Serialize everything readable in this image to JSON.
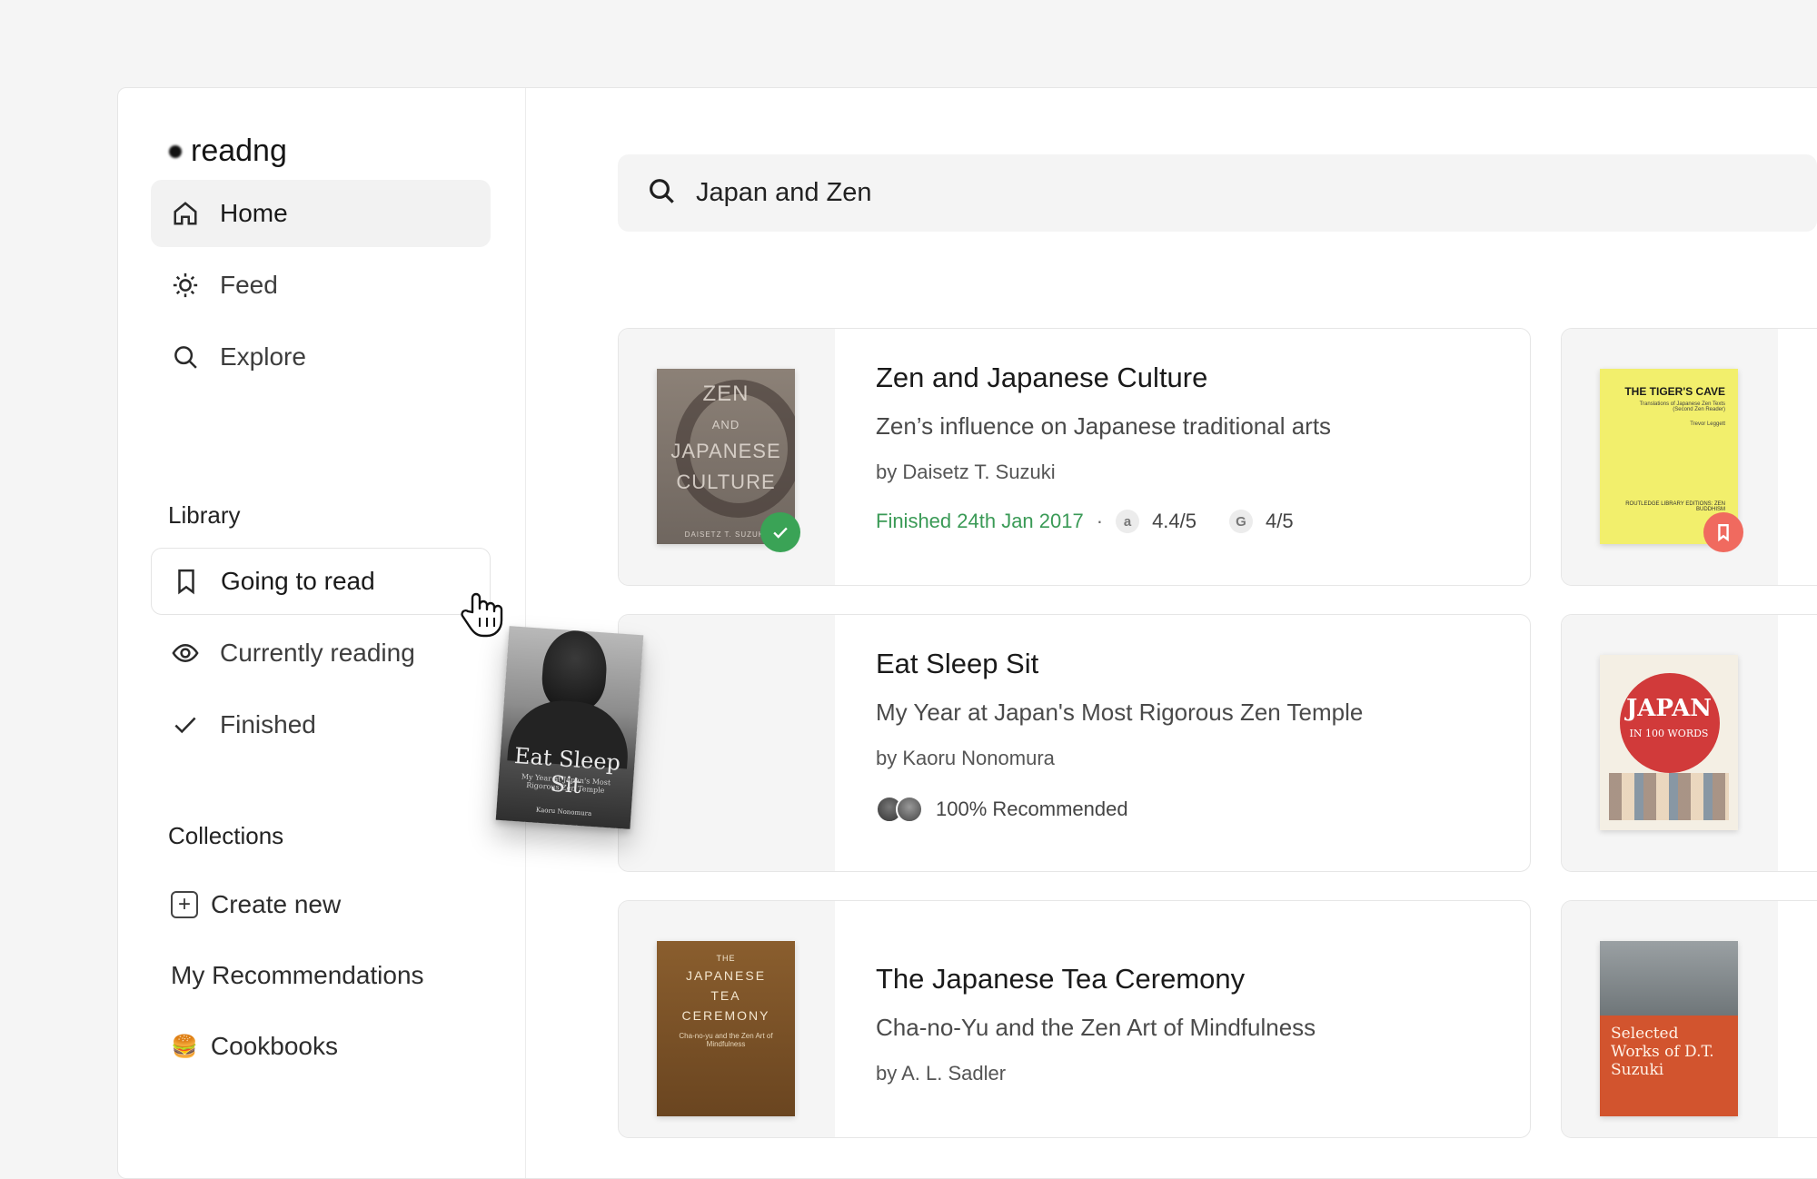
{
  "app": {
    "name": "readng"
  },
  "nav": {
    "items": [
      {
        "label": "Home",
        "icon": "home-icon"
      },
      {
        "label": "Feed",
        "icon": "sun-icon"
      },
      {
        "label": "Explore",
        "icon": "search-icon"
      }
    ]
  },
  "library": {
    "title": "Library",
    "items": [
      {
        "label": "Going to read",
        "icon": "bookmark-icon"
      },
      {
        "label": "Currently reading",
        "icon": "eye-icon"
      },
      {
        "label": "Finished",
        "icon": "check-icon"
      }
    ]
  },
  "collections": {
    "title": "Collections",
    "create_label": "Create new",
    "items": [
      {
        "label": "My Recommendations"
      },
      {
        "emoji": "🍔",
        "label": "Cookbooks"
      }
    ]
  },
  "search": {
    "query": "Japan and Zen"
  },
  "drag_book": {
    "title": "Eat Sleep Sit",
    "subtitle": "My Year at Japan's Most Rigorous Zen Temple",
    "author": "Kaoru Nonomura"
  },
  "results": [
    {
      "title": "Zen and Japanese Culture",
      "subtitle": "Zen’s influence on Japanese traditional arts",
      "author": "by Daisetz T. Suzuki",
      "status": "Finished 24th Jan 2017",
      "separator": "·",
      "amazon_rating": "4.4/5",
      "goodreads_rating": "4/5",
      "amazon_glyph": "a",
      "goodreads_glyph": "G",
      "cover": {
        "lines": [
          "ZEN",
          "AND",
          "JAPANESE",
          "CULTURE"
        ],
        "author": "DAISETZ T. SUZUKI"
      }
    },
    {
      "title": "Eat Sleep Sit",
      "subtitle": "My Year at Japan's Most Rigorous Zen Temple",
      "author": "by Kaoru Nonomura",
      "recommended": "100% Recommended"
    },
    {
      "title": "The Japanese Tea Ceremony",
      "subtitle": "Cha-no-Yu and the Zen Art of Mindfulness",
      "author": "by A. L. Sadler",
      "cover": {
        "lines": [
          "THE",
          "JAPANESE",
          "TEA",
          "CEREMONY"
        ],
        "tagline": "Cha-no-yu and the Zen Art of Mindfulness"
      }
    }
  ],
  "side_results": [
    {
      "cover": {
        "title": "THE TIGER'S CAVE",
        "subtitle": "Translations of Japanese Zen Texts (Second Zen Reader)",
        "author": "Trevor Leggett",
        "publisher": "ROUTLEDGE LIBRARY EDITIONS: ZEN BUDDHISM"
      }
    },
    {
      "cover": {
        "title": "JAPAN",
        "subtitle": "IN 100 WORDS"
      }
    },
    {
      "cover": {
        "title": "Selected Works of D.T. Suzuki"
      }
    }
  ],
  "colors": {
    "finished_green": "#3a9a56",
    "bookmark_red": "#f06a5f",
    "badge_green": "#3aa356"
  }
}
